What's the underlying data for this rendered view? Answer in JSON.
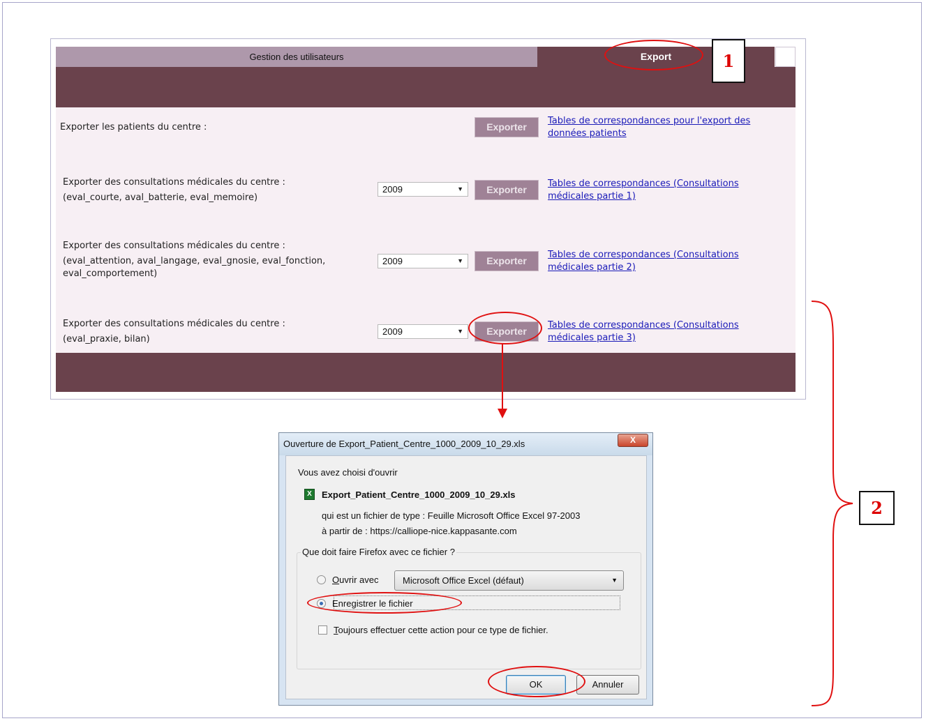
{
  "app": {
    "tabs": [
      {
        "label": "Gestion des utilisateurs"
      },
      {
        "label": "Export"
      }
    ],
    "rows": [
      {
        "line1": "Exporter les patients du centre :",
        "line2": "",
        "year": "",
        "button": "Exporter",
        "link_line1": "Tables de correspondances pour l'export des",
        "link_line2": "données patients"
      },
      {
        "line1": "Exporter des consultations médicales du centre :",
        "line2": "(eval_courte, aval_batterie, eval_memoire)",
        "year": "2009",
        "button": "Exporter",
        "link_line1": "Tables de correspondances (Consultations",
        "link_line2": "médicales partie 1)"
      },
      {
        "line1": "Exporter des consultations médicales du centre :",
        "line2": "(eval_attention, aval_langage, eval_gnosie, eval_fonction,",
        "line3": "eval_comportement)",
        "year": "2009",
        "button": "Exporter",
        "link_line1": "Tables de correspondances (Consultations",
        "link_line2": "médicales partie 2)"
      },
      {
        "line1": "Exporter des consultations médicales du centre :",
        "line2": "(eval_praxie, bilan)",
        "year": "2009",
        "button": "Exporter",
        "link_line1": "Tables de correspondances (Consultations",
        "link_line2": "médicales partie 3)"
      }
    ]
  },
  "annotations": {
    "step1": "1",
    "step2": "2"
  },
  "dialog": {
    "title": "Ouverture de Export_Patient_Centre_1000_2009_10_29.xls",
    "close_label": "X",
    "intro": "Vous avez choisi d'ouvrir",
    "filename": "Export_Patient_Centre_1000_2009_10_29.xls",
    "type_line": "qui est un fichier de type :  Feuille Microsoft Office Excel 97-2003",
    "source_line": "à partir de :  https://calliope-nice.kappasante.com",
    "group_legend": "Que doit faire Firefox avec ce fichier ?",
    "open_with_accel": "O",
    "open_with_rest": "uvrir avec",
    "open_with_app": "Microsoft Office Excel (défaut)",
    "save_label": "Enregistrer le fichier",
    "always_accel": "T",
    "always_rest": "oujours effectuer cette action pour ce type de fichier.",
    "ok_label": "OK",
    "cancel_label": "Annuler",
    "selected_option": "save"
  },
  "colors": {
    "plum_dark": "#6a424c",
    "plum_tab": "#ae98ab",
    "button": "#9f8296",
    "annotation_red": "#e01010"
  }
}
